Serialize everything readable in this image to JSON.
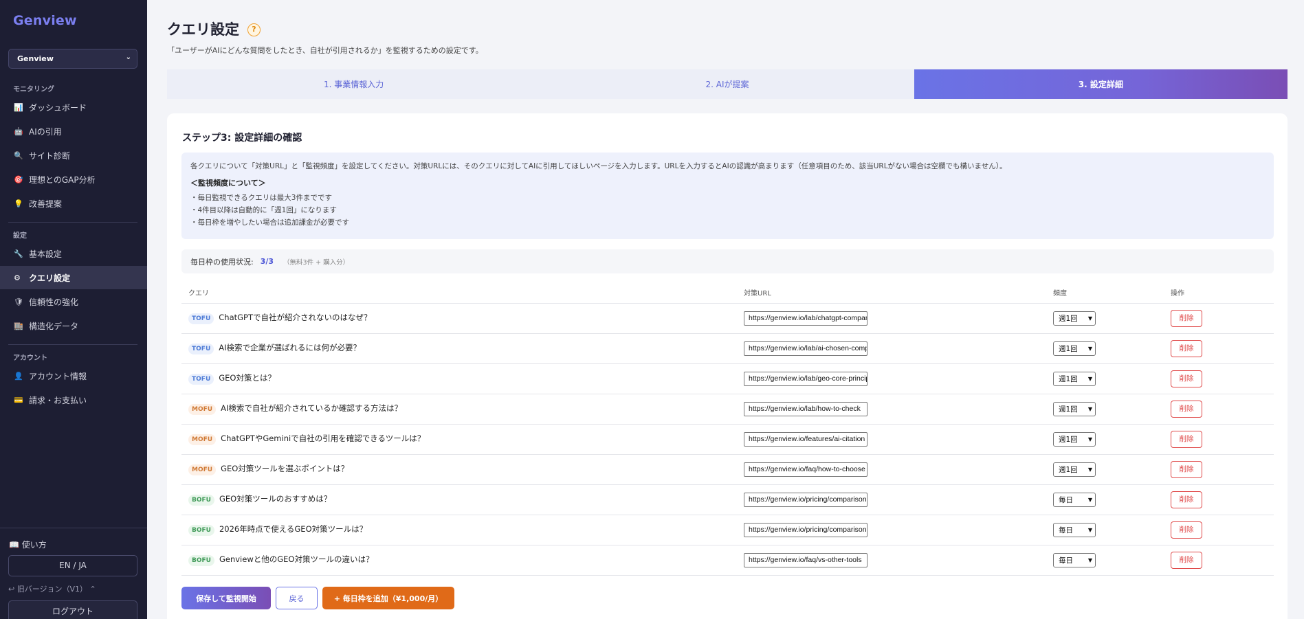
{
  "app": {
    "logo": "Genview"
  },
  "workspace": {
    "selected": "Genview"
  },
  "sidebar": {
    "sections": [
      {
        "label": "モニタリング"
      },
      {
        "label": "設定"
      },
      {
        "label": "アカウント"
      }
    ],
    "items": [
      {
        "label": "ダッシュボード",
        "icon": "chart-icon"
      },
      {
        "label": "AIの引用",
        "icon": "robot-icon"
      },
      {
        "label": "サイト診断",
        "icon": "search-icon"
      },
      {
        "label": "理想とのGAP分析",
        "icon": "target-icon"
      },
      {
        "label": "改善提案",
        "icon": "lightbulb-icon"
      },
      {
        "label": "基本設定",
        "icon": "wrench-icon"
      },
      {
        "label": "クエリ設定",
        "icon": "gear-icon"
      },
      {
        "label": "信頼性の強化",
        "icon": "shield-icon"
      },
      {
        "label": "構造化データ",
        "icon": "building-icon"
      },
      {
        "label": "アカウント情報",
        "icon": "user-icon"
      },
      {
        "label": "請求・お支払い",
        "icon": "card-icon"
      }
    ],
    "howto": "使い方",
    "lang": "EN / JA",
    "old_version": "旧バージョン（V1）",
    "logout": "ログアウト"
  },
  "page": {
    "title": "クエリ設定",
    "help": "?",
    "subtitle": "「ユーザーがAIにどんな質問をしたとき、自社が引用されるか」を監視するための設定です。"
  },
  "steps": [
    {
      "label": "1. 事業情報入力"
    },
    {
      "label": "2. AIが提案"
    },
    {
      "label": "3. 設定詳細"
    }
  ],
  "card": {
    "title": "ステップ3: 設定詳細の確認",
    "intro": "各クエリについて「対策URL」と「監視頻度」を設定してください。対策URLには、そのクエリに対してAIに引用してほしいページを入力します。URLを入力するとAIの認識が高まります（任意項目のため、該当URLがない場合は空欄でも構いません）。",
    "freq_heading": "＜監視頻度について＞",
    "bullets": [
      "・毎日監視できるクエリは最大3件までです",
      "・4件目以降は自動的に「週1回」になります",
      "・毎日枠を増やしたい場合は追加課金が必要です"
    ],
    "usage_label": "毎日枠の使用状況:",
    "usage_count": "3/3",
    "usage_note": "（無料3件 + 購入分）"
  },
  "table": {
    "headers": {
      "query": "クエリ",
      "url": "対策URL",
      "freq": "頻度",
      "action": "操作"
    },
    "rows": [
      {
        "stage": "TOFU",
        "query": "ChatGPTで自社が紹介されないのはなぜ？",
        "url": "https://genview.io/lab/chatgpt-company",
        "freq": "週1回",
        "action": "削除"
      },
      {
        "stage": "TOFU",
        "query": "AI検索で企業が選ばれるには何が必要？",
        "url": "https://genview.io/lab/ai-chosen-company",
        "freq": "週1回",
        "action": "削除"
      },
      {
        "stage": "TOFU",
        "query": "GEO対策とは？",
        "url": "https://genview.io/lab/geo-core-principles",
        "freq": "週1回",
        "action": "削除"
      },
      {
        "stage": "MOFU",
        "query": "AI検索で自社が紹介されているか確認する方法は？",
        "url": "https://genview.io/lab/how-to-check",
        "freq": "週1回",
        "action": "削除"
      },
      {
        "stage": "MOFU",
        "query": "ChatGPTやGeminiで自社の引用を確認できるツールは？",
        "url": "https://genview.io/features/ai-citation",
        "freq": "週1回",
        "action": "削除"
      },
      {
        "stage": "MOFU",
        "query": "GEO対策ツールを選ぶポイントは？",
        "url": "https://genview.io/faq/how-to-choose",
        "freq": "週1回",
        "action": "削除"
      },
      {
        "stage": "BOFU",
        "query": "GEO対策ツールのおすすめは？",
        "url": "https://genview.io/pricing/comparison",
        "freq": "毎日",
        "action": "削除"
      },
      {
        "stage": "BOFU",
        "query": "2026年時点で使えるGEO対策ツールは？",
        "url": "https://genview.io/pricing/comparison",
        "freq": "毎日",
        "action": "削除"
      },
      {
        "stage": "BOFU",
        "query": "Genviewと他のGEO対策ツールの違いは？",
        "url": "https://genview.io/faq/vs-other-tools",
        "freq": "毎日",
        "action": "削除"
      }
    ]
  },
  "buttons": {
    "save": "保存して監視開始",
    "back": "戻る",
    "add_slot": "+ 毎日枠を追加（¥1,000/月）"
  },
  "colors": {
    "sidebar_bg": "#1d1e33",
    "accent": "#6a73e6",
    "orange": "#e06a18",
    "danger": "#e04a4a"
  }
}
